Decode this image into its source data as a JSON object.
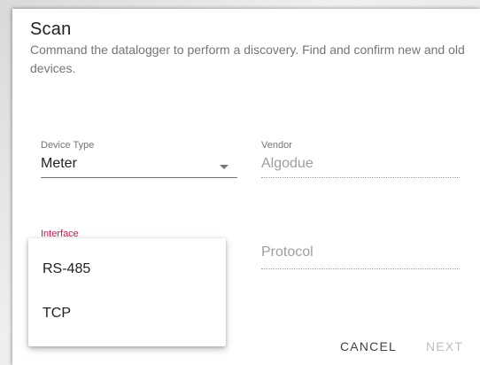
{
  "dialog": {
    "title": "Scan",
    "subtitle": "Command the datalogger to perform a discovery. Find and confirm new and old devices."
  },
  "device_type": {
    "label": "Device Type",
    "value": "Meter"
  },
  "vendor": {
    "label": "Vendor",
    "value": "Algodue"
  },
  "interface": {
    "label": "Interface",
    "options": [
      "RS-485",
      "TCP"
    ]
  },
  "protocol": {
    "placeholder": "Protocol"
  },
  "actions": {
    "cancel_label": "CANCEL",
    "next_label": "NEXT"
  },
  "colors": {
    "accent_label": "#c2185b",
    "disabled_text": "#9e9e9e"
  },
  "icons": {
    "device_type_dropdown": "chevron-down-icon"
  }
}
